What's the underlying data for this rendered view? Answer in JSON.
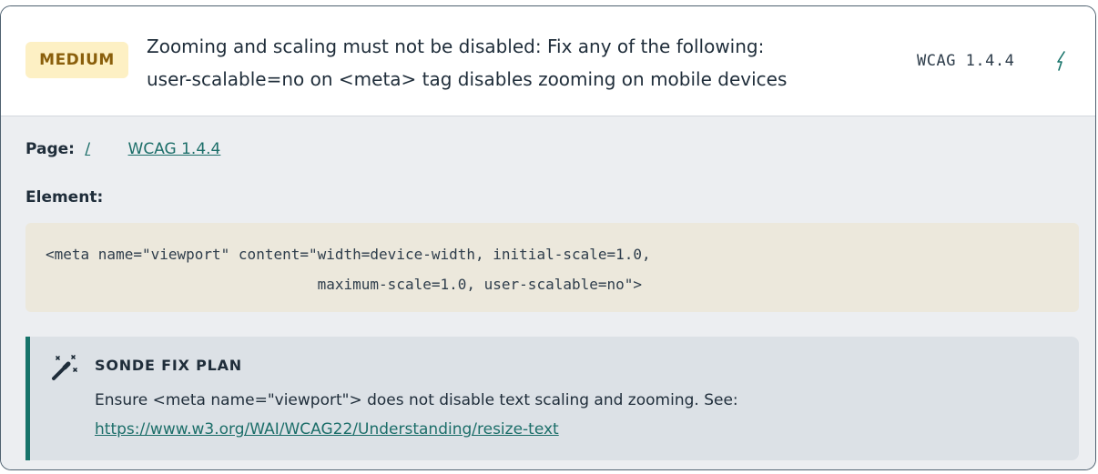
{
  "issue": {
    "severity": "MEDIUM",
    "title_line1": "Zooming and scaling must not be disabled: Fix any of the following:",
    "title_line2": "user-scalable=no on <meta> tag disables zooming on mobile devices",
    "wcag_tag": "WCAG 1.4.4",
    "icon": "bolt-icon"
  },
  "details": {
    "page_label": "Page:",
    "page_link": "/",
    "wcag_link": "WCAG 1.4.4",
    "element_label": "Element:",
    "code_line1": "<meta name=\"viewport\" content=\"width=device-width, initial-scale=1.0,",
    "code_line2": "                               maximum-scale=1.0, user-scalable=no\">"
  },
  "fix_plan": {
    "icon": "magic-wand-icon",
    "title": "SONDE FIX PLAN",
    "text": "Ensure <meta name=\"viewport\"> does not disable text scaling and zooming. See:",
    "link": "https://www.w3.org/WAI/WCAG22/Understanding/resize-text"
  },
  "colors": {
    "badge_bg": "#fdf0c4",
    "badge_text": "#8a5f0c",
    "accent": "#17736a",
    "link": "#1c6e69",
    "code_bg": "#ece8dc",
    "panel_bg": "#eceef1"
  }
}
